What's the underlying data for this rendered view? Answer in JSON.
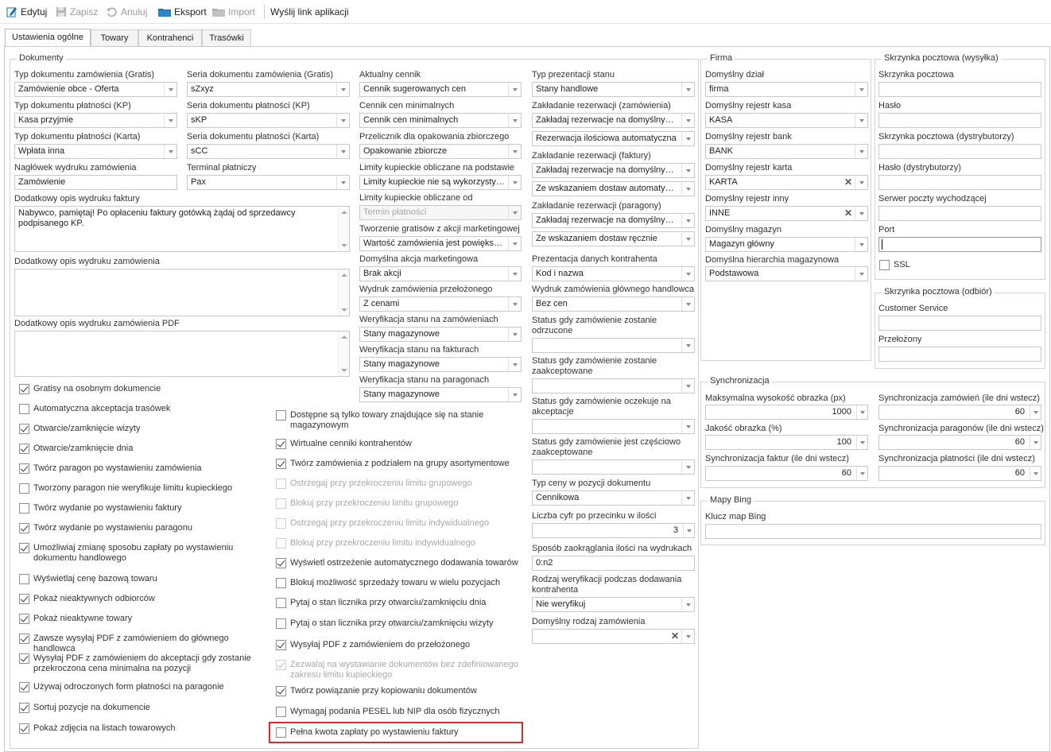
{
  "toolbar": {
    "edit": "Edytuj",
    "save": "Zapisz",
    "cancel": "Anuluj",
    "export": "Eksport",
    "import": "Import",
    "send_link": "Wyślij link aplikacji"
  },
  "tabs": [
    "Ustawienia ogólne",
    "Towary",
    "Kontrahenci",
    "Trasówki"
  ],
  "groups": {
    "dokumenty": "Dokumenty",
    "firma": "Firma",
    "mail_send": "Skrzynka pocztowa (wysyłka)",
    "mail_recv": "Skrzynka pocztowa (odbiór)",
    "sync": "Synchronizacja",
    "bing": "Mapy Bing"
  },
  "col1": {
    "l1": "Typ dokumentu zamówienia (Gratis)",
    "v1": "Zamówienie obce - Oferta",
    "l2": "Typ dokumentu płatności (KP)",
    "v2": "Kasa przyjmie",
    "l3": "Typ dokumentu płatności (Karta)",
    "v3": "Wpłata inna",
    "l4": "Nagłówek wydruku zamówienia",
    "v4": "Zamówienie",
    "l5": "Dodatkowy opis wydruku faktury",
    "v5": "Nabywco, pamiętaj! Po opłaceniu faktury gotówką żądaj od sprzedawcy podpisanego KP.",
    "l6": "Dodatkowy opis wydruku zamówienia",
    "l7": "Dodatkowy opis wydruku zamówienia PDF"
  },
  "col2": {
    "l1": "Seria dokumentu zamówienia (Gratis)",
    "v1": "sZxyz",
    "l2": "Seria dokumentu płatności (KP)",
    "v2": "sKP",
    "l3": "Seria dokumentu płatności (Karta)",
    "v3": "sCC",
    "l4": "Terminal płatniczy",
    "v4": "Pax"
  },
  "col3": {
    "l1": "Aktualny cennik",
    "v1": "Cennik sugerowanych cen",
    "l2": "Cennik cen minimalnych",
    "v2": "Cennik cen minimalnych",
    "l3": "Przelicznik dla opakowania zbiorczego",
    "v3": "Opakowanie zbiorcze",
    "l4": "Limity kupieckie obliczane na podstawie",
    "v4": "Limity kupieckie nie są wykorzystyw...",
    "l5": "Limity kupieckie obliczane od",
    "v5": "Termin płatności",
    "l6": "Tworzenie gratisów z akcji marketingowej",
    "v6": "Wartość zamówienia jest powiększa...",
    "l7": "Domyślna akcja marketingowa",
    "v7": "Brak akcji",
    "l8": "Wydruk zamówienia przełożonego",
    "v8": "Z cenami",
    "l9": "Weryfikacja stanu na zamówieniach",
    "v9": "Stany magazynowe",
    "l10": "Weryfikacja stanu na fakturach",
    "v10": "Stany magazynowe",
    "l11": "Weryfikacja stanu na paragonach",
    "v11": "Stany magazynowe"
  },
  "col4": {
    "l1": "Typ prezentacji stanu",
    "v1": "Stany handlowe",
    "l2": "Zakładanie rezerwacji (zamówienia)",
    "v2a": "Zakładaj rezerwacje na domyślnym ...",
    "v2b": "Rezerwacja ilościowa automatyczna",
    "l3": "Zakładanie rezerwacji (faktury)",
    "v3a": "Zakładaj rezerwacje na domyślnym ...",
    "v3b": "Ze wskazaniem dostaw automatycz...",
    "l4": "Zakładanie rezerwacji (paragony)",
    "v4a": "Zakładaj rezerwacje na domyślnym ...",
    "v4b": "Ze wskazaniem dostaw ręcznie",
    "l5": "Prezentacja danych kontrahenta",
    "v5": "Kod i nazwa",
    "l6": "Wydruk zamówienia głównego handlowca",
    "v6": "Bez cen",
    "l7": "Status gdy zamówienie zostanie odrzucone",
    "l8": "Status gdy zamówienie zostanie zaakceptowane",
    "l9": "Status gdy zamówienie oczekuje na akceptacje",
    "l10": "Status gdy zamówienie jest częściowo zaakceptowane",
    "l11": "Typ ceny w pozycji dokumentu",
    "v11": "Cennikowa",
    "l12": "Liczba cyfr po przecinku w ilości",
    "v12": "3",
    "l13": "Sposób zaokrąglania ilości na wydrukach",
    "v13": "0:n2",
    "l14": "Rodzaj weryfikacji podczas dodawania kontrahenta",
    "v14": "Nie weryfikuj",
    "l15": "Domyślny rodzaj zamówienia"
  },
  "checks_left": [
    {
      "label": "Gratisy na osobnym dokumencie",
      "checked": true
    },
    {
      "label": "Automatyczna akceptacja trasówek",
      "checked": false
    },
    {
      "label": "Otwarcie/zamknięcie wizyty",
      "checked": true
    },
    {
      "label": "Otwarcie/zamknięcie dnia",
      "checked": true
    },
    {
      "label": "Twórz paragon po wystawieniu zamówienia",
      "checked": true
    },
    {
      "label": "Tworzony paragon nie weryfikuje limitu kupieckiego",
      "checked": false
    },
    {
      "label": "Twórz wydanie po wystawieniu faktury",
      "checked": false
    },
    {
      "label": "Twórz wydanie po wystawieniu paragonu",
      "checked": true
    },
    {
      "label": "Umożliwiaj zmianę sposobu zapłaty po wystawieniu dokumentu handlowego",
      "checked": true
    },
    {
      "label": "Wyświetlaj cenę bazową towaru",
      "checked": false
    },
    {
      "label": "Pokaż nieaktywnych odbiorców",
      "checked": true
    },
    {
      "label": "Pokaż nieaktywne towary",
      "checked": true
    },
    {
      "label": "Zawsze wysyłaj PDF z zamówieniem do głównego handlowca",
      "checked": true
    },
    {
      "label": "Wysyłaj PDF z zamówieniem do akceptacji gdy zostanie przekroczona cena minimalna na pozycji",
      "checked": true
    },
    {
      "label": "Używaj odroczonych form płatności na paragonie",
      "checked": true
    },
    {
      "label": "Sortuj pozycje na dokumencie",
      "checked": true
    },
    {
      "label": "Pokaż zdjęcia na listach towarowych",
      "checked": true
    }
  ],
  "checks_mid": [
    {
      "label": "Dostępne są tylko towary znajdujące się na stanie magazynowym",
      "checked": false,
      "disabled": false
    },
    {
      "label": "Wirtualne cenniki kontrahentów",
      "checked": true,
      "disabled": false
    },
    {
      "label": "Twórz zamówienia z podziałem na grupy asortymentowe",
      "checked": true,
      "disabled": false
    },
    {
      "label": "Ostrzegaj przy przekroczeniu limitu grupowego",
      "checked": false,
      "disabled": true
    },
    {
      "label": "Blokuj przy przekroczeniu limitu grupowego",
      "checked": false,
      "disabled": true
    },
    {
      "label": "Ostrzegaj przy przekroczeniu limitu indywidualnego",
      "checked": false,
      "disabled": true
    },
    {
      "label": "Blokuj przy przekroczeniu limitu indywidualnego",
      "checked": false,
      "disabled": true
    },
    {
      "label": "Wyświetl ostrzeżenie automatycznego dodawania towarów",
      "checked": true,
      "disabled": false
    },
    {
      "label": "Blokuj możliwość sprzedaży towaru w wielu pozycjach",
      "checked": false,
      "disabled": false
    },
    {
      "label": "Pytaj o stan licznika przy otwarciu/zamknięciu dnia",
      "checked": false,
      "disabled": false
    },
    {
      "label": "Pytaj o stan licznika przy otwarciu/zamknięciu wizyty",
      "checked": false,
      "disabled": false
    },
    {
      "label": "Wysyłaj PDF z zamówieniem do przełożonego",
      "checked": true,
      "disabled": false
    },
    {
      "label": "Zezwalaj na wystawianie dokumentów bez zdefiniowanego zakresu limitu kupieckiego",
      "checked": true,
      "disabled": true
    },
    {
      "label": "Twórz powiązanie przy kopiowaniu dokumentów",
      "checked": true,
      "disabled": false
    },
    {
      "label": "Wymagaj podania PESEL lub NIP dla osób fizycznych",
      "checked": false,
      "disabled": false
    },
    {
      "label": "Pełna kwota zapłaty po wystawieniu faktury",
      "checked": false,
      "disabled": false
    }
  ],
  "firma": {
    "l1": "Domyślny dział",
    "v1": "firma",
    "l2": "Domyślny rejestr kasa",
    "v2": "KASA",
    "l3": "Domyślny rejestr bank",
    "v3": "BANK",
    "l4": "Domyślny rejestr karta",
    "v4": "KARTA",
    "l5": "Domyślny rejestr inny",
    "v5": "INNE",
    "l6": "Domyślny magazyn",
    "v6": "Magazyn główny",
    "l7": "Domyślna hierarchia magazynowa",
    "v7": "Podstawowa"
  },
  "mail": {
    "l1": "Skrzynka pocztowa",
    "l2": "Hasło",
    "l3": "Skrzynka pocztowa (dystrybutorzy)",
    "l4": "Hasło (dystrybutorzy)",
    "l5": "Serwer poczty wychodzącej",
    "l6": "Port",
    "ssl": "SSL"
  },
  "mail_recv": {
    "l1": "Customer Service",
    "l2": "Przełożony"
  },
  "sync": {
    "l1": "Maksymalna wysokość obrazka (px)",
    "v1": "1000",
    "l2": "Synchronizacja zamówień (ile dni wstecz)",
    "v2": "60",
    "l3": "Jakość obrazka (%)",
    "v3": "100",
    "l4": "Synchronizacja paragonów (ile dni wstecz)",
    "v4": "60",
    "l5": "Synchronizacja faktur (ile dni wstecz)",
    "v5": "60",
    "l6": "Synchronizacja płatności (ile dni wstecz)",
    "v6": "60"
  },
  "bing": {
    "l1": "Klucz map Bing"
  },
  "colors": {
    "highlight": "#e0282e",
    "accent": "#1f6fb2"
  }
}
